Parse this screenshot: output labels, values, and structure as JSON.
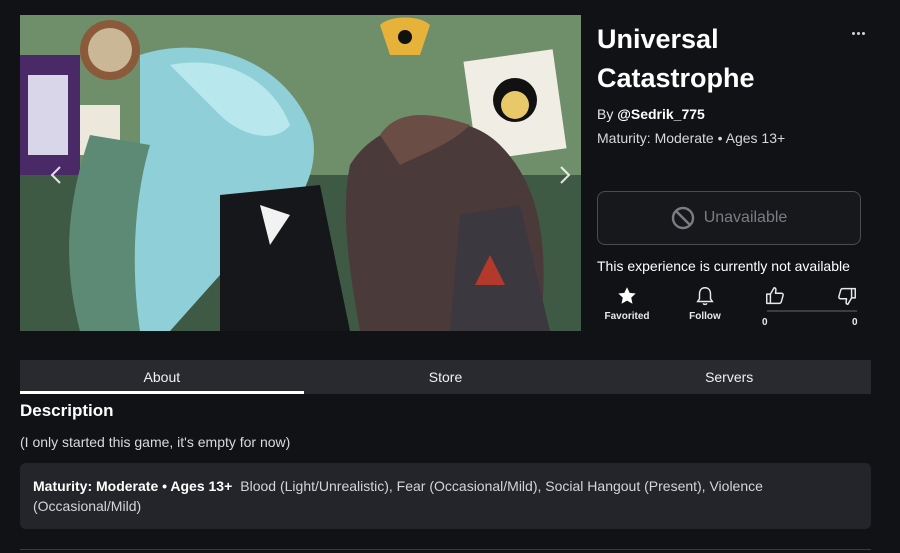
{
  "game": {
    "title": "Universal Catastrophe",
    "creator_prefix": "By ",
    "creator_handle": "@Sedrik_775",
    "maturity_line": "Maturity: Moderate • Ages 13+"
  },
  "media": {
    "prev_icon": "chevron-left-icon",
    "next_icon": "chevron-right-icon"
  },
  "play_button": {
    "label": "Unavailable",
    "icon": "block-icon"
  },
  "status_message": "This experience is currently not available",
  "actions": {
    "favorite_label": "Favorited",
    "follow_label": "Follow",
    "upvotes": "0",
    "downvotes": "0"
  },
  "tabs": [
    {
      "label": "About",
      "active": true
    },
    {
      "label": "Store",
      "active": false
    },
    {
      "label": "Servers",
      "active": false
    }
  ],
  "description": {
    "heading": "Description",
    "body": "(I only started this game, it's empty for now)"
  },
  "maturity_details": {
    "label": "Maturity: Moderate • Ages 13+",
    "text": "Blood (Light/Unrealistic), Fear (Occasional/Mild), Social Hangout (Present), Violence (Occasional/Mild)"
  },
  "colors": {
    "background": "#111216",
    "tab_bar": "#292a2f",
    "panel": "#24252a",
    "disabled_text": "#7b7d83"
  }
}
